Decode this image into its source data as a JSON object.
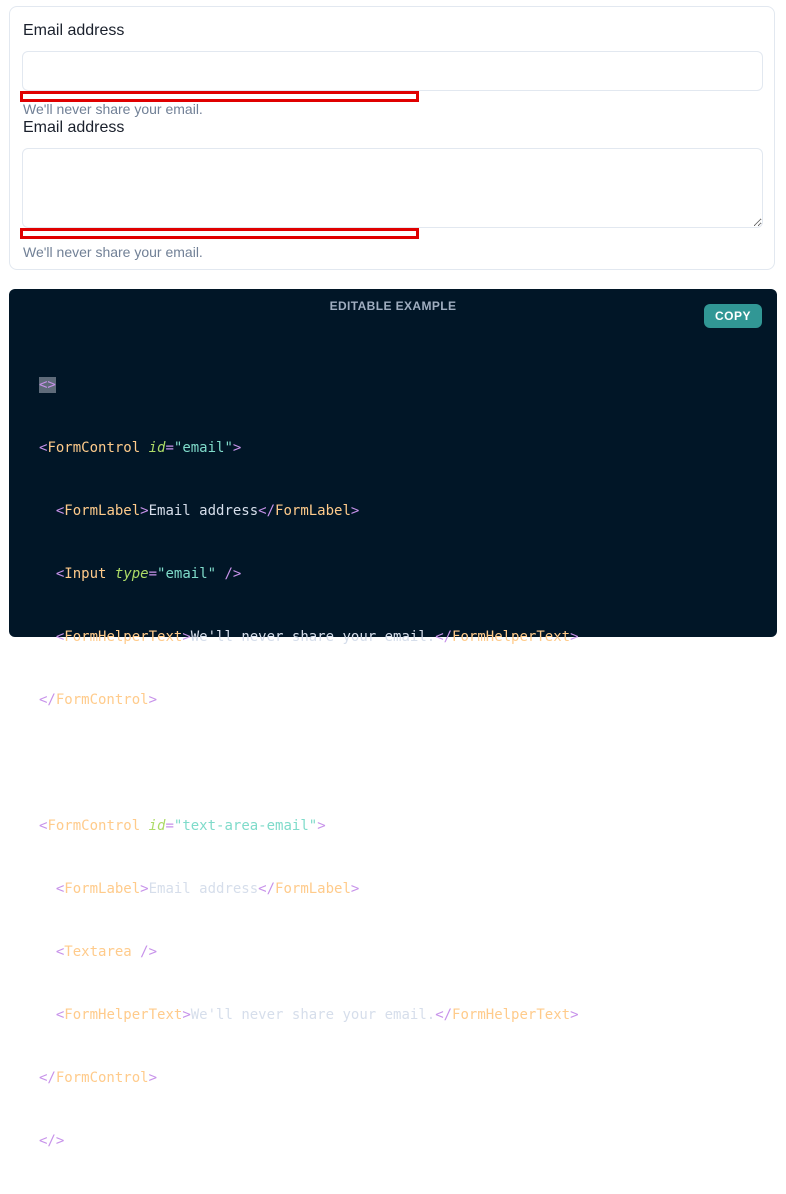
{
  "preview": {
    "field1": {
      "label": "Email address",
      "value": "",
      "helper": "We'll never share your email."
    },
    "field2": {
      "label": "Email address",
      "value": "",
      "helper": "We'll never share your email."
    }
  },
  "code_panel": {
    "title": "EDITABLE EXAMPLE",
    "copy_label": "COPY",
    "tokens": {
      "fragment_open": "<>",
      "fragment_close": "</>",
      "lt": "<",
      "lt_slash": "</",
      "gt": ">",
      "self_close": " />",
      "form_control": "FormControl",
      "form_label": "FormLabel",
      "input": "Input",
      "textarea": "Textarea",
      "form_helper_text": "FormHelperText",
      "attr_id": "id",
      "attr_type": "type",
      "eq": "=",
      "val_email": "\"email\"",
      "val_text_area_email": "\"text-area-email\"",
      "email_address_text": "Email address",
      "helper_text": "We'll never share your email."
    }
  },
  "colors": {
    "code_bg": "#011627",
    "copy_button": "#319795",
    "highlight": "#e00000",
    "tag": "#ffcb8b",
    "attr": "#addb67",
    "string": "#7fdbca",
    "punct": "#c792ea"
  }
}
